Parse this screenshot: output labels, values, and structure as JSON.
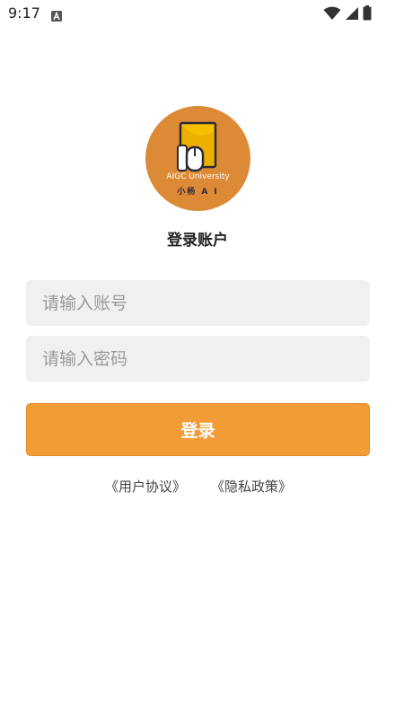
{
  "status_bar": {
    "time": "9:17",
    "icons": [
      "app-a-icon",
      "wifi-icon",
      "signal-icon",
      "battery-icon"
    ]
  },
  "logo": {
    "line1": "AIGC University",
    "line2": "小杨 A I",
    "colors": {
      "bg": "#dd8a36",
      "card": "#f5c000",
      "outline": "#2c2a3a"
    }
  },
  "page_title": "登录账户",
  "form": {
    "account_placeholder": "请输入账号",
    "account_value": "",
    "password_placeholder": "请输入密码",
    "password_value": ""
  },
  "login_button": "登录",
  "links": {
    "agreement": "《用户协议》",
    "privacy": "《隐私政策》"
  },
  "colors": {
    "accent": "#f29c38",
    "input_bg": "#eff0f1"
  }
}
